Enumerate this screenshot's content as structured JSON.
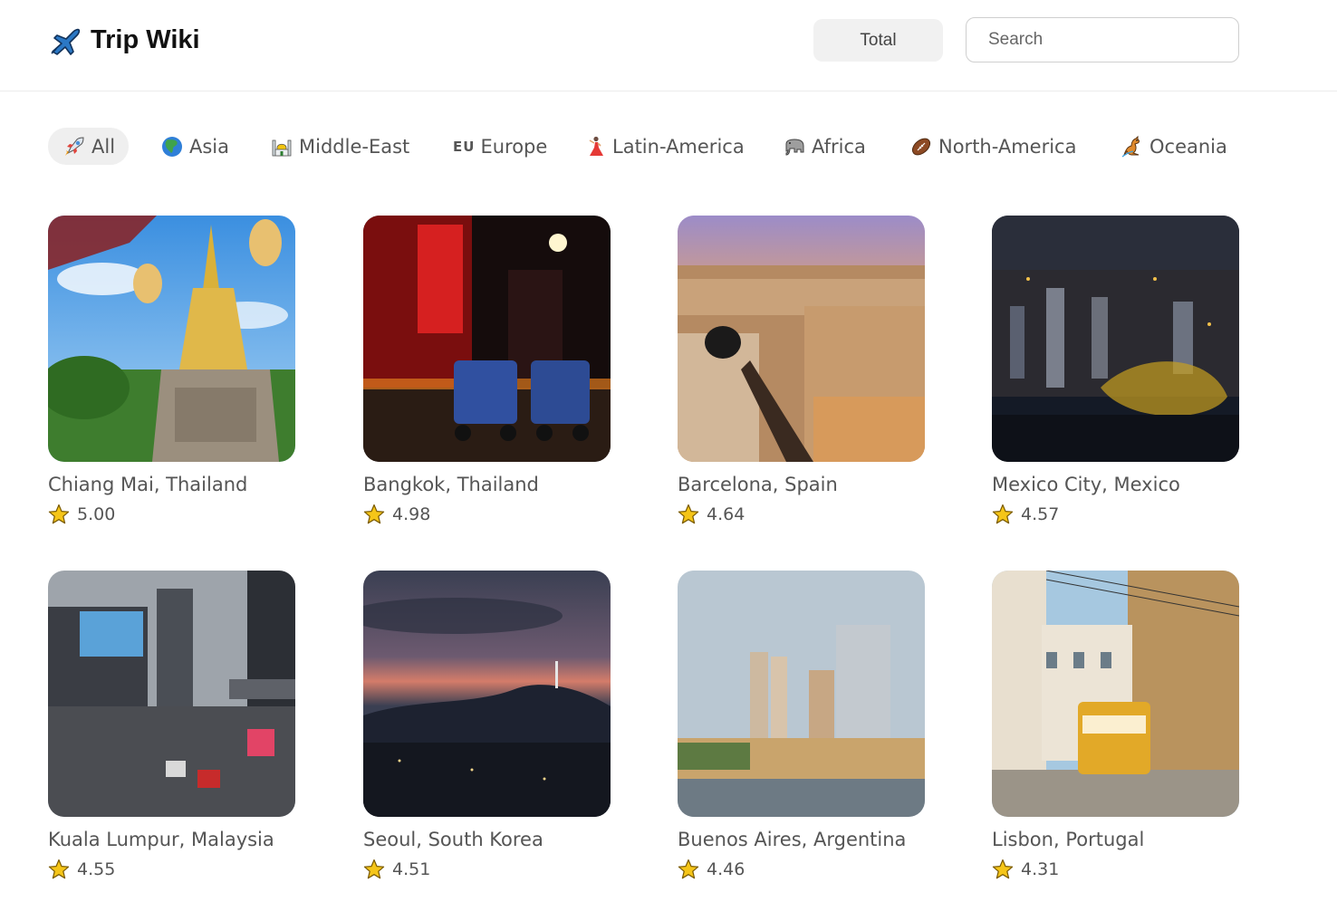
{
  "header": {
    "title": "Trip Wiki",
    "logo_icon": "airplane-icon",
    "total_label": "Total",
    "search_placeholder": "Search"
  },
  "categories": [
    {
      "label": "All",
      "icon": "rocket-icon",
      "active": true
    },
    {
      "label": "Asia",
      "icon": "globe-asia-icon",
      "active": false
    },
    {
      "label": "Middle-East",
      "icon": "mosque-icon",
      "active": false
    },
    {
      "label": "Europe",
      "icon": "eu-flag-icon",
      "icon_text": "EU",
      "active": false
    },
    {
      "label": "Latin-America",
      "icon": "dancer-icon",
      "active": false
    },
    {
      "label": "Africa",
      "icon": "elephant-icon",
      "active": false
    },
    {
      "label": "North-America",
      "icon": "football-icon",
      "active": false
    },
    {
      "label": "Oceania",
      "icon": "kangaroo-icon",
      "active": false
    }
  ],
  "destinations": [
    {
      "name": "Chiang Mai, Thailand",
      "rating": "5.00"
    },
    {
      "name": "Bangkok, Thailand",
      "rating": "4.98"
    },
    {
      "name": "Barcelona, Spain",
      "rating": "4.64"
    },
    {
      "name": "Mexico City, Mexico",
      "rating": "4.57"
    },
    {
      "name": "Kuala Lumpur, Malaysia",
      "rating": "4.55"
    },
    {
      "name": "Seoul, South Korea",
      "rating": "4.51"
    },
    {
      "name": "Buenos Aires, Argentina",
      "rating": "4.46"
    },
    {
      "name": "Lisbon, Portugal",
      "rating": "4.31"
    }
  ],
  "colors": {
    "active_chip_bg": "#efefef",
    "star_fill": "#f5c518",
    "text": "#555555"
  }
}
